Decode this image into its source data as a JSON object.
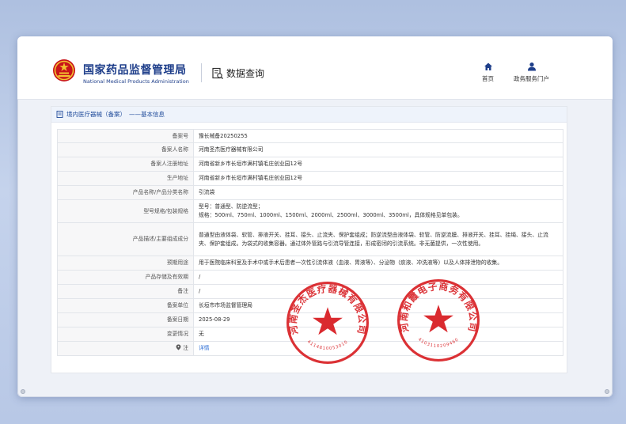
{
  "site": {
    "org_name_cn": "国家药品监督管理局",
    "org_name_en": "National Medical Products Administration",
    "data_query_label": "数据查询",
    "nav": {
      "home": "首页",
      "service_portal": "政务服务门户"
    }
  },
  "section": {
    "title": "境内医疗器械（备案）",
    "subtitle": "——基本信息"
  },
  "record": {
    "rows": [
      {
        "label": "备案号",
        "value": "豫长械备20250255"
      },
      {
        "label": "备案人名称",
        "value": "河南圣杰医疗器械有限公司"
      },
      {
        "label": "备案人注册地址",
        "value": "河南省新乡市长垣市满村镇毛庄创业园12号"
      },
      {
        "label": "生产地址",
        "value": "河南省新乡市长垣市满村镇毛庄创业园12号"
      },
      {
        "label": "产品名称/产品分类名称",
        "value": "引流袋"
      },
      {
        "label": "型号规格/包装规格",
        "value": "型号：普通型、防逆流型；\n规格：500ml、750ml、1000ml、1500ml、2000ml、2500ml、3000ml、3500ml，具体规格见单包装。"
      },
      {
        "label": "产品描述/主要组成成分",
        "value": "普通型由液体袋、软管、排液开关、挂耳、接头、止流夹、保护套组成；防逆流型由液体袋、软管、防逆流膜、排液开关、挂耳、挂绳、接头、止流夹、保护套组成。为袋式的收集容器。通过体外管路与引流导管连接，形成密闭的引流系统。非无菌提供，一次性使用。"
      },
      {
        "label": "预期用途",
        "value": "用于医院临床科室及手术中或手术后患者一次性引流体液（血液、胃液等）、分泌物（痰液、冲洗液等）以及人体排泄物的收集。"
      },
      {
        "label": "产品存储及有效期",
        "value": "/"
      },
      {
        "label": "备注",
        "value": "/"
      },
      {
        "label": "备案单位",
        "value": "长垣市市场监督管理局"
      },
      {
        "label": "备案日期",
        "value": "2025-08-29"
      },
      {
        "label": "变更情况",
        "value": "无"
      },
      {
        "label": "注",
        "value": "详情"
      }
    ]
  },
  "stamps": {
    "stamp1_text": "河南圣杰医疗器械有限公司",
    "stamp1_code": "4114810053010",
    "stamp2_text": "河南和霞电子商务有限公司",
    "stamp2_code": "4103110209460"
  },
  "colors": {
    "brand": "#1e3e8a",
    "accent": "#2f6fd6",
    "stamp": "#d81f24"
  }
}
